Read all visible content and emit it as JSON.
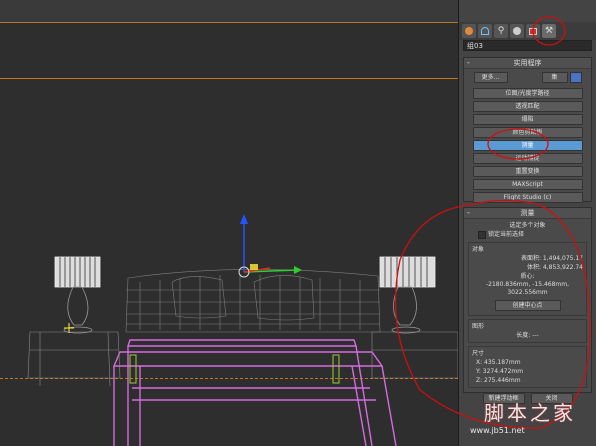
{
  "panel": {
    "object_name": "组03",
    "tabs": [
      {
        "icon": "sphere-icon"
      },
      {
        "icon": "curve-icon"
      },
      {
        "icon": "hierarchy-icon"
      },
      {
        "icon": "motion-icon"
      },
      {
        "icon": "display-icon"
      },
      {
        "icon": "hammer-icon"
      }
    ],
    "utilities": {
      "title": "实用程序",
      "more_label": "更多...",
      "sets_label": "集",
      "buttons": [
        "位图/光度学路径",
        "透视匹配",
        "塌陷",
        "颜色剪贴板",
        "测量",
        "运动捕捉",
        "重置变换",
        "MAXScript",
        "Flight Studio (c)"
      ],
      "selected_index": 4
    },
    "measure": {
      "title": "测量",
      "subtitle": "选定多个对象",
      "lock_label": "锁定当前选择",
      "objects_label": "对象",
      "surface_area": "表面积: 1,494,075.17",
      "volume": "体积: 4,853,922.74",
      "center_label": "质心:",
      "center_value": "-2180.836mm, -15.468mm, 3022.556mm",
      "create_center_label": "创建中心点",
      "shapes_label": "图形",
      "length_label": "长度: ---",
      "dimensions_label": "尺寸",
      "x_value": "X:  435.187mm",
      "y_value": "Y:  3274.472mm",
      "z_value": "Z:  275.446mm",
      "new_float_label": "新建浮动框",
      "close_label": "关闭"
    }
  },
  "watermark": {
    "text": "脚本之家",
    "url": "www.jb51.net"
  },
  "colors": {
    "wire_pink": "#d56be0",
    "wire_gray": "#8a8a8a",
    "annotation_red": "#cc1010",
    "selection_blue": "#5b9bd5"
  }
}
